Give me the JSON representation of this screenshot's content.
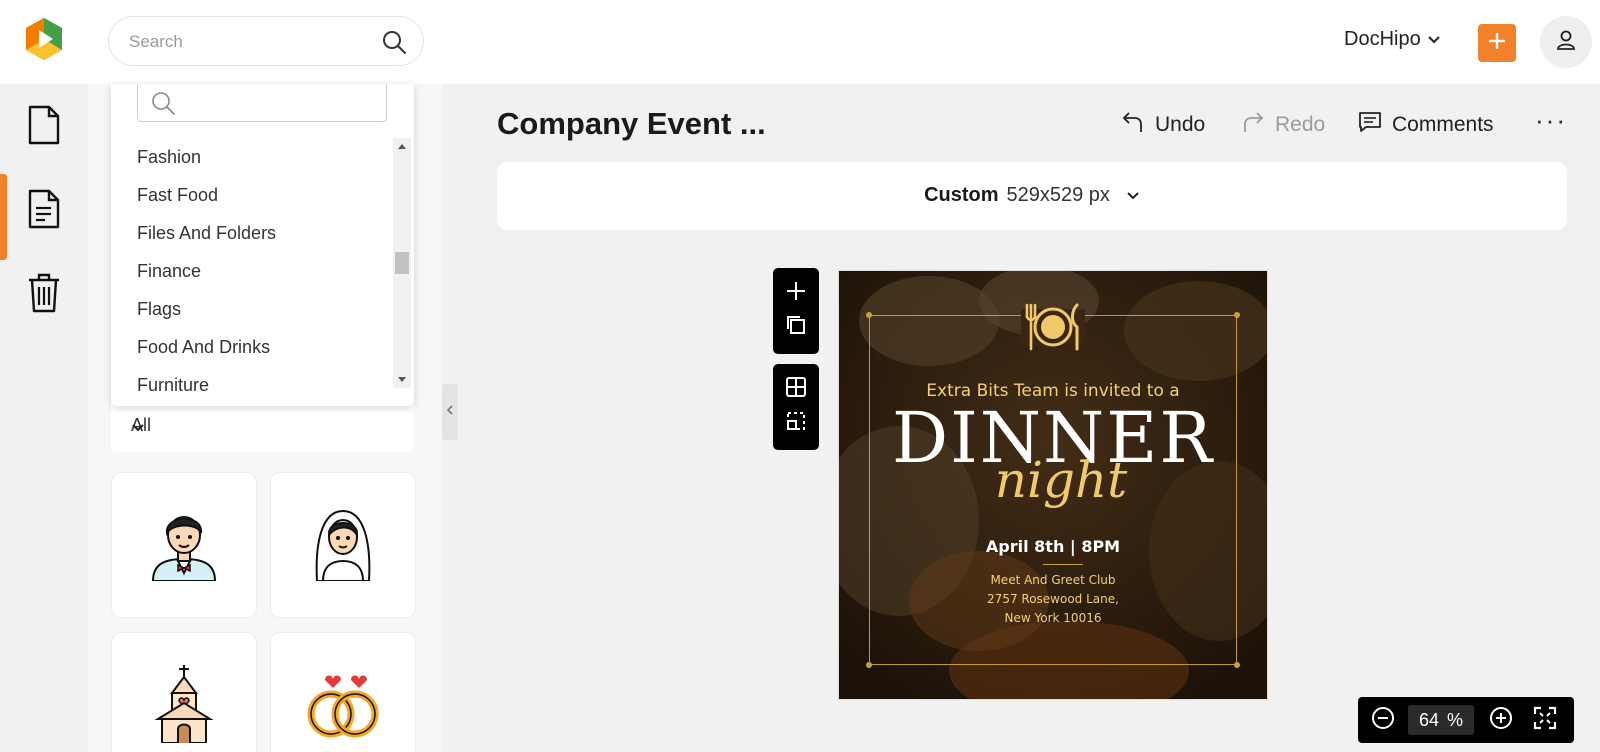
{
  "header": {
    "search_placeholder": "Search",
    "account_name": "DocHipo",
    "brand_color": "#f28129"
  },
  "sidebar": {
    "items": [
      {
        "name": "page-icon"
      },
      {
        "name": "document-icon",
        "active": true
      },
      {
        "name": "trash-icon"
      }
    ]
  },
  "panel": {
    "category_search_placeholder": "",
    "categories": [
      "Fashion",
      "Fast Food",
      "Files And Folders",
      "Finance",
      "Flags",
      "Food And Drinks",
      "Furniture"
    ],
    "filter_value": "All",
    "tiles": [
      {
        "name": "groom-icon"
      },
      {
        "name": "bride-icon"
      },
      {
        "name": "chapel-icon"
      },
      {
        "name": "wedding-rings-icon"
      }
    ]
  },
  "editor": {
    "title": "Company Event ...",
    "undo_label": "Undo",
    "redo_label": "Redo",
    "comments_label": "Comments",
    "size_type": "Custom",
    "size_value": "529x529 px"
  },
  "design": {
    "invite_line": "Extra Bits Team is invited to a",
    "headline": "DINNER",
    "script_word": "night",
    "date_line": "April 8th | 8PM",
    "address_lines": [
      "Meet And Greet Club",
      "2757 Rosewood Lane,",
      "New York 10016"
    ],
    "accent_color": "#c9a236"
  },
  "zoom": {
    "value": "64",
    "unit": "%"
  }
}
